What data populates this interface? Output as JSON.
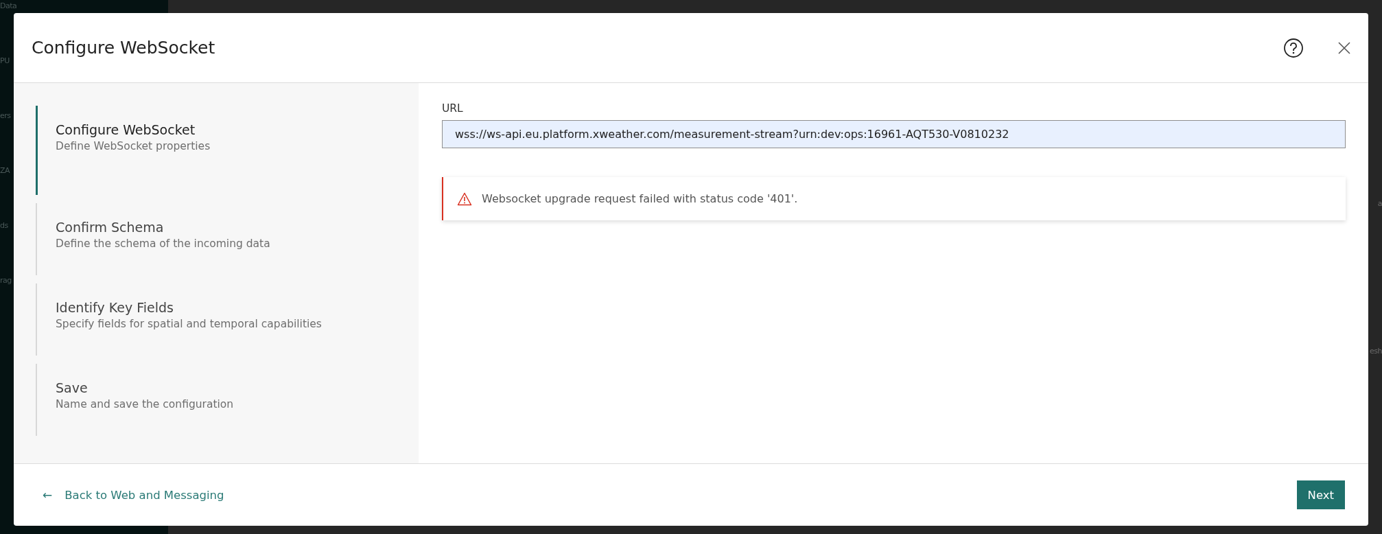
{
  "background": {
    "sidebar_items": [
      "Data",
      "PU",
      "ers",
      "ZA",
      "ds",
      "rag"
    ],
    "right_fragments": [
      "a",
      "esh"
    ]
  },
  "dialog": {
    "title": "Configure WebSocket",
    "steps": [
      {
        "title": "Configure WebSocket",
        "description": "Define WebSocket properties",
        "selected": true
      },
      {
        "title": "Confirm Schema",
        "description": "Define the schema of the incoming data",
        "selected": false
      },
      {
        "title": "Identify Key Fields",
        "description": "Specify fields for spatial and temporal capabilities",
        "selected": false
      },
      {
        "title": "Save",
        "description": "Name and save the configuration",
        "selected": false
      }
    ],
    "url_field": {
      "label": "URL",
      "value": "wss://ws-api.eu.platform.xweather.com/measurement-stream?urn:dev:ops:16961-AQT530-V0810232"
    },
    "alert": {
      "kind": "error",
      "message": "Websocket upgrade request failed with status code '401'."
    },
    "back_link": {
      "arrow": "←",
      "label": "Back to Web and Messaging"
    },
    "next_button": "Next"
  }
}
